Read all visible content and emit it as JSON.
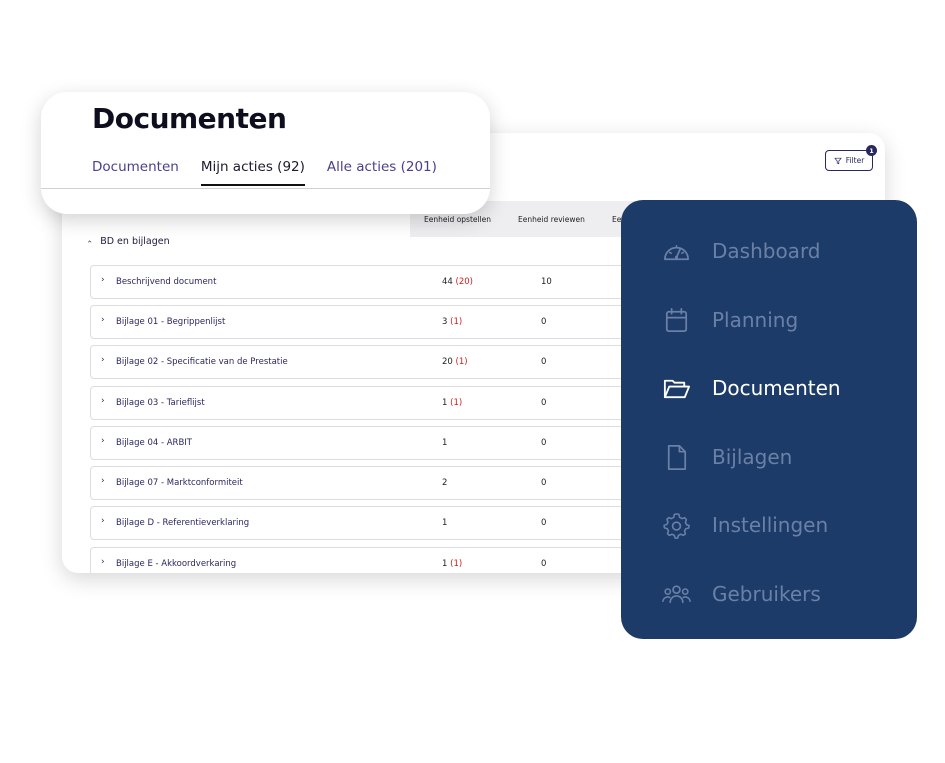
{
  "filter": {
    "label": "Filter",
    "count": "1"
  },
  "table": {
    "columns": [
      "Eenheid opstellen",
      "Eenheid reviewen",
      "Ee"
    ],
    "group": "BD en bijlagen",
    "rows": [
      {
        "name": "Beschrijvend document",
        "c1": "44",
        "c1_red": "(20)",
        "c2": "10"
      },
      {
        "name": "Bijlage 01 - Begrippenlijst",
        "c1": "3",
        "c1_red": "(1)",
        "c2": "0"
      },
      {
        "name": "Bijlage 02 - Specificatie van de Prestatie",
        "c1": "20",
        "c1_red": "(1)",
        "c2": "0"
      },
      {
        "name": "Bijlage 03 - Tarieflijst",
        "c1": "1",
        "c1_red": "(1)",
        "c2": "0"
      },
      {
        "name": "Bijlage 04 - ARBIT",
        "c1": "1",
        "c1_red": "",
        "c2": "0"
      },
      {
        "name": "Bijlage 07 - Marktconformiteit",
        "c1": "2",
        "c1_red": "",
        "c2": "0"
      },
      {
        "name": "Bijlage D - Referentieverklaring",
        "c1": "1",
        "c1_red": "",
        "c2": "0"
      },
      {
        "name": "Bijlage E - Akkoordverkaring",
        "c1": "1",
        "c1_red": "(1)",
        "c2": "0"
      }
    ]
  },
  "header": {
    "title": "Documenten",
    "tabs": [
      {
        "label": "Documenten"
      },
      {
        "label": "Mijn acties (92)"
      },
      {
        "label": "Alle acties (201)"
      }
    ],
    "active_tab": "Mijn acties (92)"
  },
  "sidebar": {
    "items": [
      {
        "label": "Dashboard",
        "icon": "gauge-icon"
      },
      {
        "label": "Planning",
        "icon": "calendar-icon"
      },
      {
        "label": "Documenten",
        "icon": "folder-open-icon"
      },
      {
        "label": "Bijlagen",
        "icon": "file-icon"
      },
      {
        "label": "Instellingen",
        "icon": "gear-icon"
      },
      {
        "label": "Gebruikers",
        "icon": "users-icon"
      }
    ],
    "active": "Documenten"
  },
  "colors": {
    "sidebar_bg": "#1d3b69",
    "sidebar_inactive": "#6a80a6",
    "accent": "#2a2660",
    "warning_red": "#d02020"
  }
}
